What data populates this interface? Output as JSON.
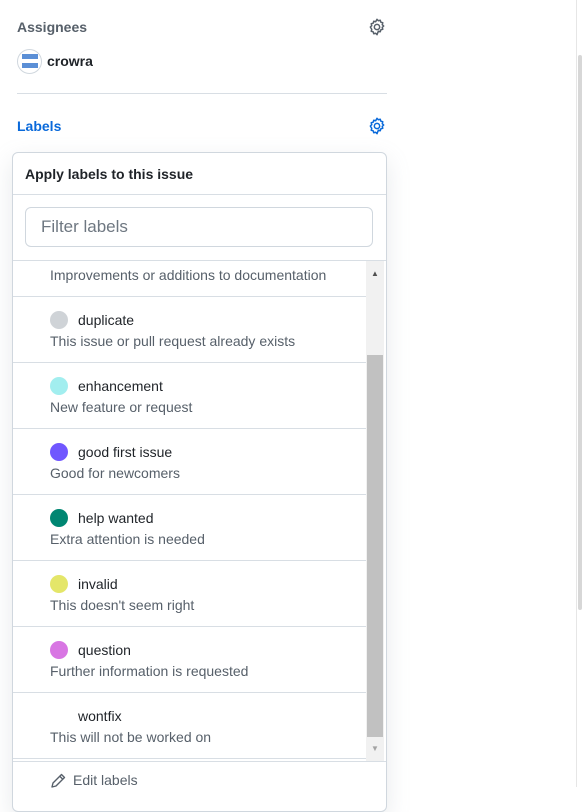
{
  "assignees": {
    "title": "Assignees",
    "user": {
      "name": "crowra"
    }
  },
  "labels": {
    "title": "Labels",
    "accent_color": "#0969da",
    "popover": {
      "title": "Apply labels to this issue",
      "filter_placeholder": "Filter labels",
      "filter_value": "",
      "items": [
        {
          "name": "",
          "description": "Improvements or additions to documentation",
          "color": null
        },
        {
          "name": "duplicate",
          "description": "This issue or pull request already exists",
          "color": "#cfd3d7"
        },
        {
          "name": "enhancement",
          "description": "New feature or request",
          "color": "#a2eeef"
        },
        {
          "name": "good first issue",
          "description": "Good for newcomers",
          "color": "#7057ff"
        },
        {
          "name": "help wanted",
          "description": "Extra attention is needed",
          "color": "#008672"
        },
        {
          "name": "invalid",
          "description": "This doesn't seem right",
          "color": "#e4e669"
        },
        {
          "name": "question",
          "description": "Further information is requested",
          "color": "#d876e3"
        },
        {
          "name": "wontfix",
          "description": "This will not be worked on",
          "color": "#ffffff"
        }
      ],
      "footer": {
        "edit_label": "Edit labels"
      }
    }
  }
}
